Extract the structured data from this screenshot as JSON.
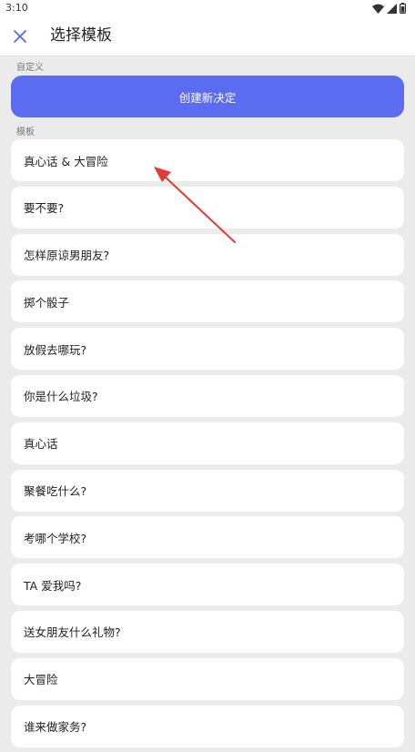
{
  "status_bar": {
    "time": "3:10",
    "icons": [
      "wifi-icon",
      "signal-icon",
      "battery-icon"
    ]
  },
  "header": {
    "close_icon": "close-icon",
    "title": "选择模板"
  },
  "custom_section": {
    "label": "自定义",
    "create_button_label": "创建新决定"
  },
  "template_section": {
    "label": "模板",
    "items": [
      "真心话 & 大冒险",
      "要不要?",
      "怎样原谅男朋友?",
      "掷个骰子",
      "放假去哪玩?",
      "你是什么垃圾?",
      "真心话",
      "聚餐吃什么?",
      "考哪个学校?",
      "TA 爱我吗?",
      "送女朋友什么礼物?",
      "大冒险",
      "谁来做家务?"
    ]
  },
  "colors": {
    "accent": "#5b6cf0",
    "background": "#ebebeb",
    "card": "#ffffff",
    "annotation_arrow": "#e53935"
  }
}
